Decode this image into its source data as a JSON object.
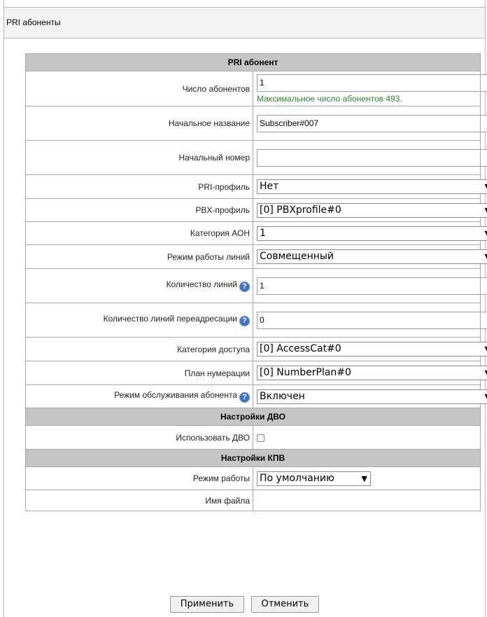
{
  "panel": {
    "title": "PRI абоненты"
  },
  "sections": {
    "main": "PRI абонент",
    "dvo": "Настройки ДВО",
    "kpv": "Настройки КПВ"
  },
  "fields": {
    "subscriber_count": {
      "label": "Число абонентов",
      "value": "1",
      "hint": "Максимальное число абонентов 493."
    },
    "initial_name": {
      "label": "Начальное название",
      "value": "Subscriber#007"
    },
    "initial_number": {
      "label": "Начальный номер",
      "value": ""
    },
    "pri_profile": {
      "label": "PRI-профиль",
      "value": "Нет"
    },
    "pbx_profile": {
      "label": "PBX-профиль",
      "value": "[0] PBXprofile#0"
    },
    "aon_category": {
      "label": "Категория АОН",
      "value": "1"
    },
    "line_mode": {
      "label": "Режим работы линий",
      "value": "Совмещенный"
    },
    "line_count": {
      "label": "Количество линий",
      "value": "1"
    },
    "redirect_line_count": {
      "label": "Количество линий переадресации",
      "value": "0"
    },
    "access_category": {
      "label": "Категория доступа",
      "value": "[0] AccessCat#0"
    },
    "numbering_plan": {
      "label": "План нумерации",
      "value": "[0] NumberPlan#0"
    },
    "service_mode": {
      "label": "Режим обслуживания абонента",
      "value": "Включен"
    },
    "use_dvo": {
      "label": "Использовать ДВО",
      "checked": false
    },
    "work_mode": {
      "label": "Режим работы",
      "value": "По умолчанию"
    },
    "file_name": {
      "label": "Имя файла",
      "value": ""
    }
  },
  "buttons": {
    "apply": "Применить",
    "cancel": "Отменить"
  },
  "icons": {
    "help": "question-help-icon",
    "dropdown": "dropdown-arrow-icon"
  },
  "colors": {
    "hint": "#2a8a2a",
    "section_bg": "#c6c6c6",
    "help_icon": "#3d73c7"
  }
}
